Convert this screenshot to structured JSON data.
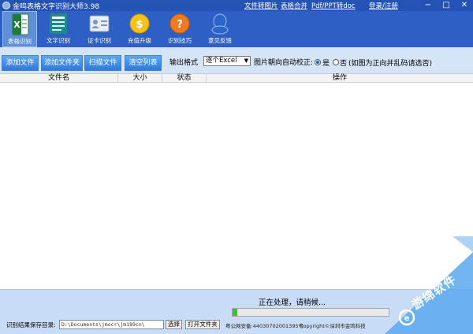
{
  "title_bar": {
    "app_title": "金鸣表格文字识别大师3.98",
    "links": [
      "文件转图片",
      "表格合并",
      "Pdf/PPT转doc",
      "登录/注册"
    ],
    "minimize": "−",
    "restore": "□",
    "close": "✕"
  },
  "toolbar": {
    "items": [
      {
        "label": "表格识别",
        "icon": "excel-icon",
        "active": true
      },
      {
        "label": "文字识别",
        "icon": "document-icon",
        "active": false
      },
      {
        "label": "证卡识别",
        "icon": "id-card-icon",
        "active": false
      },
      {
        "label": "充值升级",
        "icon": "coin-icon",
        "active": false
      },
      {
        "label": "识别技巧",
        "icon": "help-icon",
        "active": false
      },
      {
        "label": "意见反馈",
        "icon": "qq-icon",
        "active": false
      }
    ]
  },
  "actions": {
    "buttons": [
      "添加文件",
      "添加文件夹",
      "扫描文件",
      "清空列表"
    ],
    "output_format_label": "输出格式",
    "output_format_value": "逐个Excel",
    "orientation_label": "图片朝向自动校正:",
    "option_yes": "是",
    "option_no": "否",
    "option_no_hint": "(如图为正向并乱码请选否)",
    "selected_option": "是"
  },
  "table": {
    "columns": [
      "文件名",
      "大小",
      "状态",
      "操作"
    ],
    "rows": []
  },
  "bottom": {
    "status": "正在处理，请稍候...",
    "progress_fraction": 0.03,
    "save_dir_label": "识别结果保存目录:",
    "save_dir_value": "D:\\Documents\\jmocr\\jm189cn\\",
    "choose_button": "选择",
    "open_folder_button": "打开文件夹",
    "icp_text": "粤公网安备:44030702001395号",
    "copyright_text": "Copyright©深圳市金鸣科技"
  },
  "watermark": {
    "text": "游绵软件"
  },
  "colors": {
    "title_bar": "#2552b5",
    "toolbar": "#2d5fc4",
    "action_bar": "#d6e4f7",
    "button": "#2f79d9",
    "bottom_bar": "#c9dcf5",
    "progress": "#3ac23a"
  }
}
